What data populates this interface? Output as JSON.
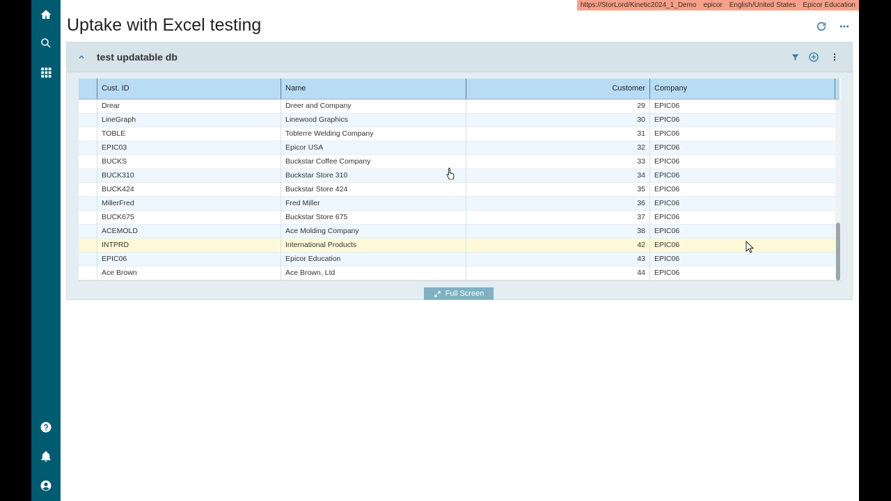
{
  "window": {
    "title": "Uptake with Excel testing"
  },
  "env": {
    "url": "https://StorLord/Kinetic2024_1_Demo",
    "user": "epicor",
    "language": "English/United States",
    "company": "Epicor Education"
  },
  "panel": {
    "title": "test updatable db",
    "fullscreen_label": "Full Screen"
  },
  "grid": {
    "columns": [
      "Cust. ID",
      "Name",
      "Customer",
      "Company"
    ],
    "rows": [
      {
        "cust_id": "Drear",
        "name": "Dreer and Company",
        "customer": "29",
        "company": "EPIC06"
      },
      {
        "cust_id": "LineGraph",
        "name": "Linewood Graphics",
        "customer": "30",
        "company": "EPIC06"
      },
      {
        "cust_id": "TOBLE",
        "name": "Toblerre Welding Company",
        "customer": "31",
        "company": "EPIC06"
      },
      {
        "cust_id": "EPIC03",
        "name": "Epicor USA",
        "customer": "32",
        "company": "EPIC06"
      },
      {
        "cust_id": "BUCKS",
        "name": "Buckstar Coffee Company",
        "customer": "33",
        "company": "EPIC06"
      },
      {
        "cust_id": "BUCK310",
        "name": "Buckstar Store 310",
        "customer": "34",
        "company": "EPIC06"
      },
      {
        "cust_id": "BUCK424",
        "name": "Buckstar Store 424",
        "customer": "35",
        "company": "EPIC06"
      },
      {
        "cust_id": "MillerFred",
        "name": "Fred Miller",
        "customer": "36",
        "company": "EPIC06"
      },
      {
        "cust_id": "BUCK675",
        "name": "Buckstar Store 675",
        "customer": "37",
        "company": "EPIC06"
      },
      {
        "cust_id": "ACEMOLD",
        "name": "Ace Molding Company",
        "customer": "38",
        "company": "EPIC06"
      },
      {
        "cust_id": "INTPRD",
        "name": "International Products",
        "customer": "42",
        "company": "EPIC06"
      },
      {
        "cust_id": "EPIC06",
        "name": "Epicor Education",
        "customer": "43",
        "company": "EPIC06"
      },
      {
        "cust_id": "Ace Brown",
        "name": "Ace Brown, Ltd",
        "customer": "44",
        "company": "EPIC06"
      }
    ]
  },
  "colors": {
    "sidebar": "#005b70",
    "header": "#b9dcf5",
    "accent": "#7fb1c3",
    "selected": "#fdf9d8"
  }
}
